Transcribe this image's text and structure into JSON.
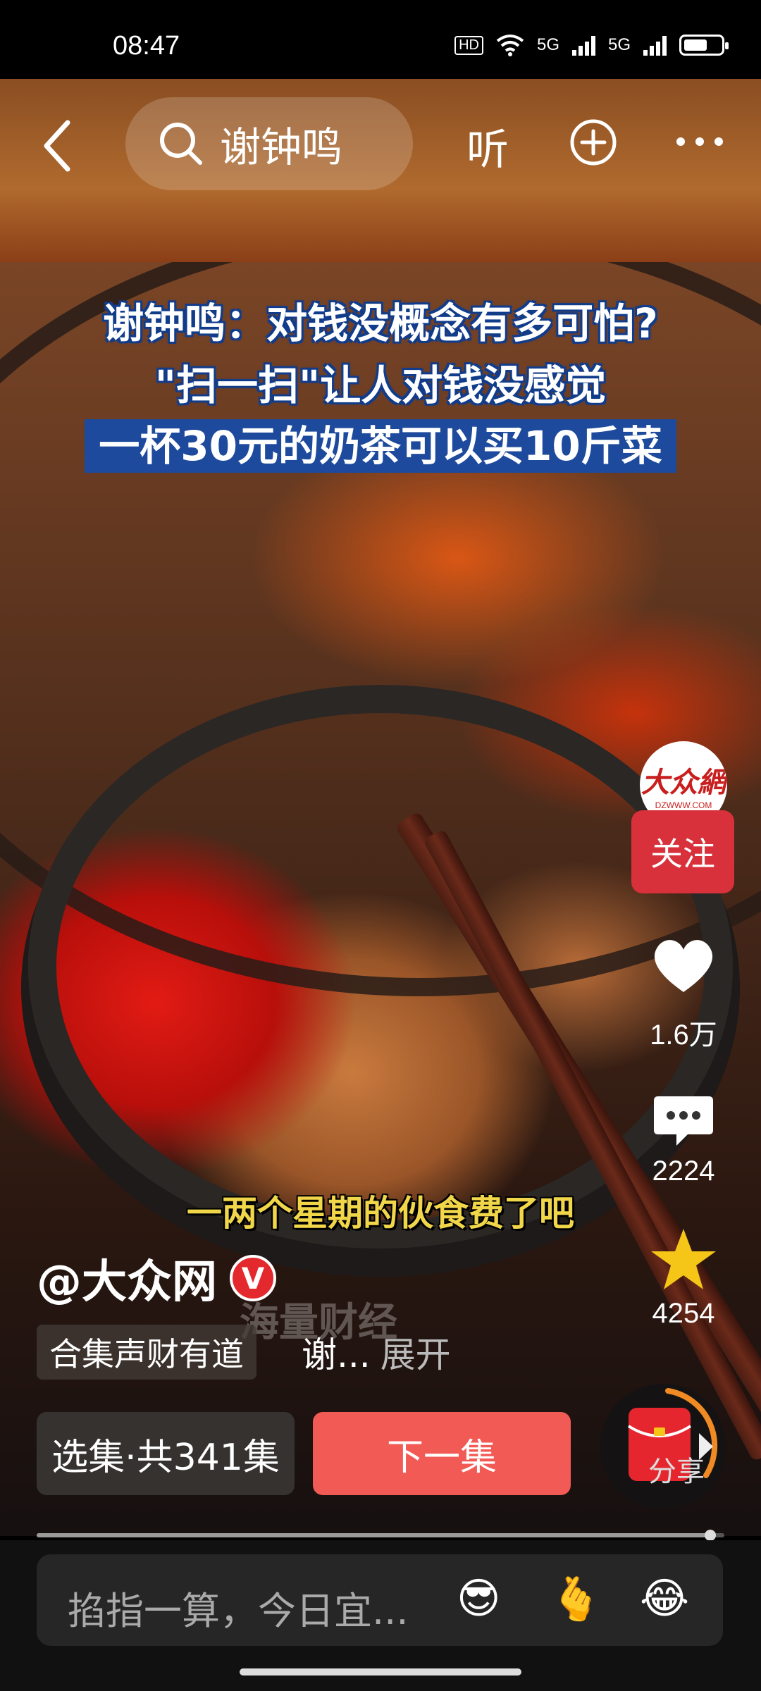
{
  "status_bar": {
    "time": "08:47",
    "hd": "HD",
    "net1": "5G",
    "net2": "5G",
    "battery_level": 0.7
  },
  "header": {
    "search_text": "谢钟鸣",
    "listen_label": "听"
  },
  "video": {
    "caption_line1": "谢钟鸣：对钱没概念有多可怕?",
    "caption_line2": "\"扫一扫\"让人对钱没感觉",
    "caption_line3": "一杯30元的奶茶可以买10斤菜",
    "subtitle": "一两个星期的伙食费了吧",
    "watermark": "海量财经"
  },
  "rail": {
    "avatar_logo": "大众網",
    "avatar_sub": "DZWWW.COM",
    "follow_label": "关注",
    "likes": "1.6万",
    "comments": "2224",
    "favorites": "4254",
    "share_label": "分享"
  },
  "info": {
    "author": "@大众网",
    "verified_mark": "V",
    "collection_tag": "合集声财有道",
    "description": "谢...",
    "expand_label": "展开",
    "episodes_label": "选集·共341集",
    "next_label": "下一集"
  },
  "progress": {
    "fraction": 0.98
  },
  "comment": {
    "placeholder": "掐指一算，今日宜...",
    "emojis": [
      "😎",
      "🫰",
      "😂"
    ]
  },
  "colors": {
    "accent_red": "#f25a55",
    "follow_red": "#d8313b",
    "star_yellow": "#f5c518",
    "subtitle_yellow": "#f1d64a"
  }
}
